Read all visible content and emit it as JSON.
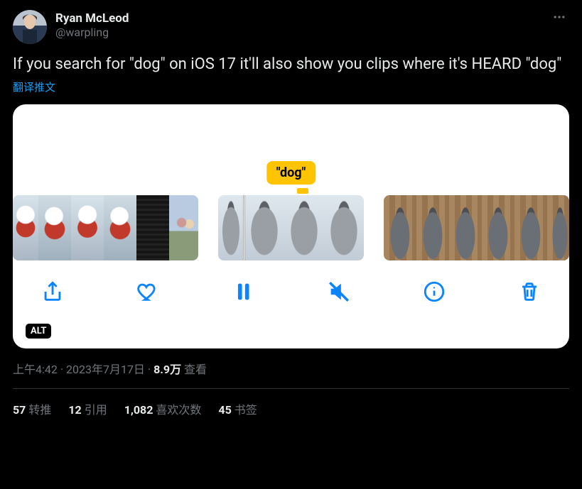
{
  "author": {
    "display_name": "Ryan McLeod",
    "handle": "@warpling"
  },
  "tweet_text": "If you search for \"dog\" on iOS 17 it'll also show you clips where it's HEARD \"dog\"",
  "translate_label": "翻译推文",
  "media": {
    "caption_bubble": "\"dog\"",
    "alt_badge": "ALT",
    "toolbar_icons": [
      "share",
      "heart",
      "pause",
      "mute",
      "info",
      "trash"
    ]
  },
  "meta": {
    "time": "上午4:42",
    "dot1": " · ",
    "date": "2023年7月17日",
    "dot2": " · ",
    "views_number": "8.9万",
    "views_label": " 查看"
  },
  "stats": {
    "retweets_num": "57",
    "retweets_label": "转推",
    "quotes_num": "12",
    "quotes_label": "引用",
    "likes_num": "1,082",
    "likes_label": "喜欢次数",
    "bookmarks_num": "45",
    "bookmarks_label": "书签"
  }
}
